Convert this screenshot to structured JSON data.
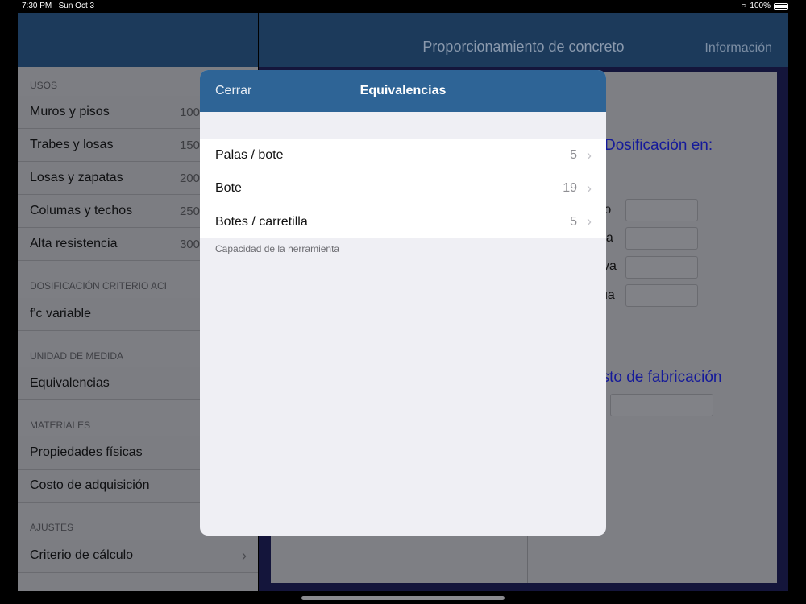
{
  "status": {
    "time": "7:30 PM",
    "date": "Sun Oct 3",
    "battery": "100%"
  },
  "sidebar": {
    "sections": [
      {
        "header": "USOS",
        "rows": [
          {
            "label": "Muros y pisos",
            "value": "100"
          },
          {
            "label": "Trabes y losas",
            "value": "150"
          },
          {
            "label": "Losas y zapatas",
            "value": "200"
          },
          {
            "label": "Columas y techos",
            "value": "250"
          },
          {
            "label": "Alta resistencia",
            "value": "300"
          }
        ]
      },
      {
        "header": "DOSIFICACIÓN CRITERIO ACI",
        "rows": [
          {
            "label": "f'c variable"
          }
        ]
      },
      {
        "header": "UNIDAD DE MEDIDA",
        "rows": [
          {
            "label": "Equivalencias"
          }
        ]
      },
      {
        "header": "MATERIALES",
        "rows": [
          {
            "label": "Propiedades físicas"
          },
          {
            "label": "Costo de adquisición"
          }
        ]
      },
      {
        "header": "AJUSTES",
        "rows": [
          {
            "label": "Criterio de cálculo",
            "chevron": "›"
          }
        ]
      }
    ]
  },
  "detail": {
    "title": "Proporcionamiento de concreto",
    "info_button": "Información",
    "dosificacion_title": "Dosificación en:",
    "fields": [
      "nto",
      "na",
      "va",
      "ua"
    ],
    "costo_title": "osto de fabricación"
  },
  "modal": {
    "close_label": "Cerrar",
    "title": "Equivalencias",
    "rows": [
      {
        "label": "Palas / bote",
        "value": "5"
      },
      {
        "label": "Bote",
        "value": "19"
      },
      {
        "label": "Botes / carretilla",
        "value": "5"
      }
    ],
    "footer": "Capacidad de la herramienta",
    "chevron": "›"
  }
}
